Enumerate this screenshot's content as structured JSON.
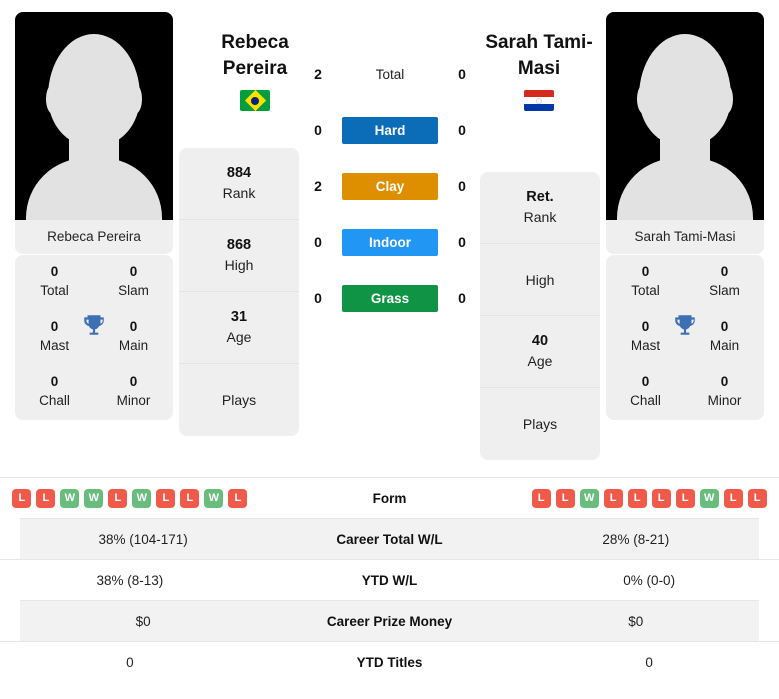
{
  "players": {
    "left": {
      "name": "Rebeca Pereira",
      "display_name_line1": "Rebeca",
      "display_name_line2": "Pereira",
      "flag": "brazil-flag",
      "rank": "884",
      "rank_label": "Rank",
      "high": "868",
      "high_label": "High",
      "age": "31",
      "age_label": "Age",
      "plays": "",
      "plays_label": "Plays",
      "titles": {
        "total": "0",
        "total_label": "Total",
        "slam": "0",
        "slam_label": "Slam",
        "mast": "0",
        "mast_label": "Mast",
        "main": "0",
        "main_label": "Main",
        "chall": "0",
        "chall_label": "Chall",
        "minor": "0",
        "minor_label": "Minor"
      },
      "form": [
        "L",
        "L",
        "W",
        "W",
        "L",
        "W",
        "L",
        "L",
        "W",
        "L"
      ],
      "career_total_wl": "38% (104-171)",
      "ytd_wl": "38% (8-13)",
      "career_prize_money": "$0",
      "ytd_titles": "0"
    },
    "right": {
      "name": "Sarah Tami-Masi",
      "display_name_line1": "Sarah Tami-",
      "display_name_line2": "Masi",
      "flag": "paraguay-flag",
      "rank": "Ret.",
      "rank_label": "Rank",
      "high": "",
      "high_label": "High",
      "age": "40",
      "age_label": "Age",
      "plays": "",
      "plays_label": "Plays",
      "titles": {
        "total": "0",
        "total_label": "Total",
        "slam": "0",
        "slam_label": "Slam",
        "mast": "0",
        "mast_label": "Mast",
        "main": "0",
        "main_label": "Main",
        "chall": "0",
        "chall_label": "Chall",
        "minor": "0",
        "minor_label": "Minor"
      },
      "form": [
        "L",
        "L",
        "W",
        "L",
        "L",
        "L",
        "L",
        "W",
        "L",
        "L"
      ],
      "career_total_wl": "28% (8-21)",
      "ytd_wl": "0% (0-0)",
      "career_prize_money": "$0",
      "ytd_titles": "0"
    }
  },
  "head_to_head": [
    {
      "label": "Total",
      "left": "2",
      "right": "0",
      "color": "",
      "badge": false
    },
    {
      "label": "Hard",
      "left": "0",
      "right": "0",
      "color": "#0b6cb7",
      "badge": true
    },
    {
      "label": "Clay",
      "left": "2",
      "right": "0",
      "color": "#dd8f00",
      "badge": true
    },
    {
      "label": "Indoor",
      "left": "0",
      "right": "0",
      "color": "#2196f3",
      "badge": true
    },
    {
      "label": "Grass",
      "left": "0",
      "right": "0",
      "color": "#0e9444",
      "badge": true
    }
  ],
  "table_rows": [
    {
      "label": "Form",
      "left": "",
      "right": "",
      "type": "form"
    },
    {
      "label": "Career Total W/L",
      "left": "38% (104-171)",
      "right": "28% (8-21)",
      "type": "text"
    },
    {
      "label": "YTD W/L",
      "left": "38% (8-13)",
      "right": "0% (0-0)",
      "type": "text"
    },
    {
      "label": "Career Prize Money",
      "left": "$0",
      "right": "$0",
      "type": "text"
    },
    {
      "label": "YTD Titles",
      "left": "0",
      "right": "0",
      "type": "text"
    }
  ],
  "colors": {
    "hard": "#0b6cb7",
    "clay": "#dd8f00",
    "indoor": "#2196f3",
    "grass": "#0e9444",
    "win": "#68bd7d",
    "loss": "#f05a4a",
    "trophy": "#3d6fb4",
    "card_bg": "#efefef"
  }
}
